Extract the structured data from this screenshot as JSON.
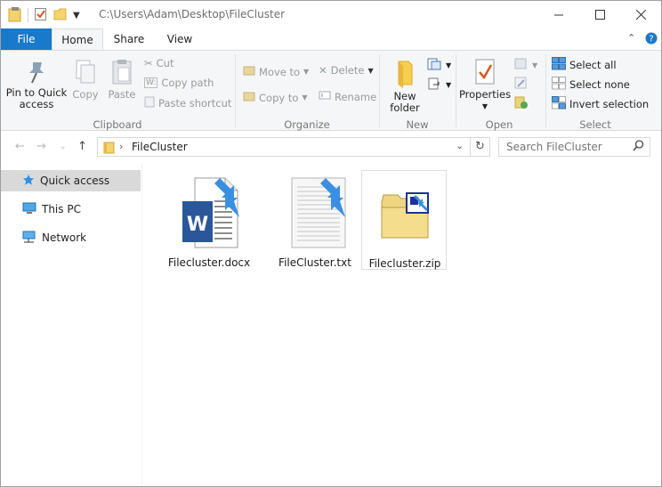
{
  "titlebar": {
    "path": "C:\\Users\\Adam\\Desktop\\FileCluster"
  },
  "tabs": {
    "file": "File",
    "home": "Home",
    "share": "Share",
    "view": "View"
  },
  "ribbon": {
    "clipboard": {
      "label": "Clipboard",
      "pin": "Pin to Quick access",
      "copy": "Copy",
      "paste": "Paste",
      "cut": "Cut",
      "copy_path": "Copy path",
      "paste_shortcut": "Paste shortcut"
    },
    "organize": {
      "label": "Organize",
      "move_to": "Move to",
      "copy_to": "Copy to",
      "delete": "Delete",
      "rename": "Rename"
    },
    "new": {
      "label": "New",
      "new_folder": "New folder"
    },
    "open": {
      "label": "Open",
      "properties": "Properties"
    },
    "select": {
      "label": "Select",
      "select_all": "Select all",
      "select_none": "Select none",
      "invert_selection": "Invert selection"
    }
  },
  "address": {
    "current_folder": "FileCluster",
    "search_placeholder": "Search FileCluster"
  },
  "navpane": {
    "items": [
      {
        "label": "Quick access",
        "icon": "star-icon"
      },
      {
        "label": "This PC",
        "icon": "computer-icon"
      },
      {
        "label": "Network",
        "icon": "network-icon"
      }
    ]
  },
  "files": [
    {
      "name": "Filecluster.docx",
      "type": "word-document-icon"
    },
    {
      "name": "FileCluster.txt",
      "type": "text-document-icon"
    },
    {
      "name": "Filecluster.zip",
      "type": "zip-folder-icon"
    }
  ],
  "colors": {
    "accent": "#1979ca",
    "ribbon_bg": "#f5f6f7",
    "selected_nav": "#d9d9d9",
    "compressed_arrow": "#3b8fe0"
  }
}
